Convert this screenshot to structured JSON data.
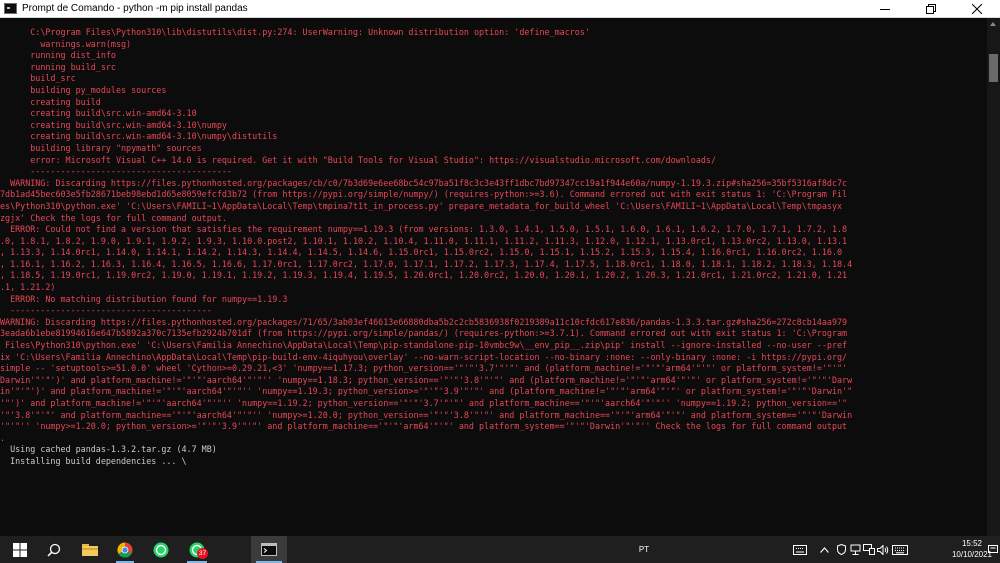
{
  "window": {
    "title": "Prompt de Comando - python  -m pip install pandas",
    "minimize_icon": "minimize-icon",
    "maximize_icon": "restore-icon",
    "close_icon": "close-icon"
  },
  "console": {
    "colors": {
      "error": "#e74856",
      "normal": "#cccccc",
      "background": "#0c0c0c"
    },
    "lines": [
      {
        "t": "      C:\\Program Files\\Python310\\lib\\distutils\\dist.py:274: UserWarning: Unknown distribution option: 'define_macros'",
        "c": "r"
      },
      {
        "t": "        warnings.warn(msg)",
        "c": "r"
      },
      {
        "t": "      running dist_info",
        "c": "r"
      },
      {
        "t": "      running build_src",
        "c": "r"
      },
      {
        "t": "      build_src",
        "c": "r"
      },
      {
        "t": "      building py_modules sources",
        "c": "r"
      },
      {
        "t": "      creating build",
        "c": "r"
      },
      {
        "t": "      creating build\\src.win-amd64-3.10",
        "c": "r"
      },
      {
        "t": "      creating build\\src.win-amd64-3.10\\numpy",
        "c": "r"
      },
      {
        "t": "      creating build\\src.win-amd64-3.10\\numpy\\distutils",
        "c": "r"
      },
      {
        "t": "      building library \"npymath\" sources",
        "c": "r"
      },
      {
        "t": "      error: Microsoft Visual C++ 14.0 is required. Get it with \"Build Tools for Visual Studio\": https://visualstudio.microsoft.com/downloads/",
        "c": "r"
      },
      {
        "t": "      ----------------------------------------",
        "c": "r"
      },
      {
        "t": "  WARNING: Discarding https://files.pythonhosted.org/packages/cb/c0/7b3d69e6ee68bc54c97ba51f8c3c3e43ff1dbc7bd97347cc19a1f944e60a/numpy-1.19.3.zip#sha256=35bf5316af8dc7c",
        "c": "r"
      },
      {
        "t": "7db1ad45bec603e5fb28671beb98ebd1d65e8059efcfd3b72 (from https://pypi.org/simple/numpy/) (requires-python:>=3.6). Command errored out with exit status 1: 'C:\\Program Fil",
        "c": "r"
      },
      {
        "t": "es\\Python310\\python.exe' 'C:\\Users\\FAMILI~1\\AppData\\Local\\Temp\\tmpina7t1t_in_process.py' prepare_metadata_for_build_wheel 'C:\\Users\\FAMILI~1\\AppData\\Local\\Temp\\tmpasyx",
        "c": "r"
      },
      {
        "t": "zgjx' Check the logs for full command output.",
        "c": "r"
      },
      {
        "t": "  ERROR: Could not find a version that satisfies the requirement numpy==1.19.3 (from versions: 1.3.0, 1.4.1, 1.5.0, 1.5.1, 1.6.0, 1.6.1, 1.6.2, 1.7.0, 1.7.1, 1.7.2, 1.8",
        "c": "r"
      },
      {
        "t": ".0, 1.8.1, 1.8.2, 1.9.0, 1.9.1, 1.9.2, 1.9.3, 1.10.0.post2, 1.10.1, 1.10.2, 1.10.4, 1.11.0, 1.11.1, 1.11.2, 1.11.3, 1.12.0, 1.12.1, 1.13.0rc1, 1.13.0rc2, 1.13.0, 1.13.1",
        "c": "r"
      },
      {
        "t": ", 1.13.3, 1.14.0rc1, 1.14.0, 1.14.1, 1.14.2, 1.14.3, 1.14.4, 1.14.5, 1.14.6, 1.15.0rc1, 1.15.0rc2, 1.15.0, 1.15.1, 1.15.2, 1.15.3, 1.15.4, 1.16.0rc1, 1.16.0rc2, 1.16.0",
        "c": "r"
      },
      {
        "t": ", 1.16.1, 1.16.2, 1.16.3, 1.16.4, 1.16.5, 1.16.6, 1.17.0rc1, 1.17.0rc2, 1.17.0, 1.17.1, 1.17.2, 1.17.3, 1.17.4, 1.17.5, 1.18.0rc1, 1.18.0, 1.18.1, 1.18.2, 1.18.3, 1.18.4",
        "c": "r"
      },
      {
        "t": ", 1.18.5, 1.19.0rc1, 1.19.0rc2, 1.19.0, 1.19.1, 1.19.2, 1.19.3, 1.19.4, 1.19.5, 1.20.0rc1, 1.20.0rc2, 1.20.0, 1.20.1, 1.20.2, 1.20.3, 1.21.0rc1, 1.21.0rc2, 1.21.0, 1.21",
        "c": "r"
      },
      {
        "t": ".1, 1.21.2)",
        "c": "r"
      },
      {
        "t": "  ERROR: No matching distribution found for numpy==1.19.3",
        "c": "r"
      },
      {
        "t": "  ----------------------------------------",
        "c": "r"
      },
      {
        "t": "WARNING: Discarding https://files.pythonhosted.org/packages/71/65/3ab03ef46613e66880dba5b2c2cb5836938f0219389a11c10cfdc617e836/pandas-1.3.3.tar.gz#sha256=272c8cb14aa979",
        "c": "r"
      },
      {
        "t": "3eada6b1ebe81994616e647b5892a370c7135efb2924b701df (from https://pypi.org/simple/pandas/) (requires-python:>=3.7.1). Command errored out with exit status 1: 'C:\\Program",
        "c": "r"
      },
      {
        "t": " Files\\Python310\\python.exe' 'C:\\Users\\Familia Annechino\\AppData\\Local\\Temp\\pip-standalone-pip-10vmbc9w\\__env_pip__.zip\\pip' install --ignore-installed --no-user --pref",
        "c": "r"
      },
      {
        "t": "ix 'C:\\Users\\Familia Annechino\\AppData\\Local\\Temp\\pip-build-env-4iquhyou\\overlay' --no-warn-script-location --no-binary :none: --only-binary :none: -i https://pypi.org/",
        "c": "r"
      },
      {
        "t": "simple -- 'setuptools>=51.0.0' wheel 'Cython>=0.29.21,<3' 'numpy==1.17.3; python_version=='\"'\"'3.7'\"'\"' and (platform_machine!='\"'\"'arm64'\"'\"' or platform_system!='\"'\"'",
        "c": "r"
      },
      {
        "t": "Darwin'\"'\"')' and platform_machine!='\"'\"'aarch64'\"'\"'' 'numpy==1.18.3; python_version=='\"'\"'3.8'\"'\"' and (platform_machine!='\"'\"'arm64'\"'\"' or platform_system!='\"'\"'Darw",
        "c": "r"
      },
      {
        "t": "in'\"'\"')' and platform_machine!='\"'\"'aarch64'\"'\"'' 'numpy==1.19.3; python_version>='\"'\"'3.9'\"'\"' and (platform_machine!='\"'\"'arm64'\"'\"' or platform_system!='\"'\"'Darwin'\"",
        "c": "r"
      },
      {
        "t": "'\"')' and platform_machine!='\"'\"'aarch64'\"'\"'' 'numpy==1.19.2; python_version=='\"'\"'3.7'\"'\"' and platform_machine=='\"'\"'aarch64'\"'\"'' 'numpy==1.19.2; python_version=='\"",
        "c": "r"
      },
      {
        "t": "'\"'3.8'\"'\"' and platform_machine=='\"'\"'aarch64'\"'\"'' 'numpy>=1.20.0; python_version=='\"'\"'3.8'\"'\"' and platform_machine=='\"'\"'arm64'\"'\"' and platform_system=='\"'\"'Darwin",
        "c": "r"
      },
      {
        "t": "'\"'\"'' 'numpy>=1.20.0; python_version>='\"'\"'3.9'\"'\"' and platform_machine=='\"'\"'arm64'\"'\"' and platform_system=='\"'\"'Darwin'\"'\"'' Check the logs for full command output",
        "c": "r"
      },
      {
        "t": ".",
        "c": "r"
      },
      {
        "t": "  Using cached pandas-1.3.2.tar.gz (4.7 MB)",
        "c": "w"
      },
      {
        "t": "  Installing build dependencies ... \\",
        "c": "w"
      }
    ]
  },
  "taskbar": {
    "start_icon": "windows-start-icon",
    "search_icon": "search-icon",
    "apps": [
      {
        "name": "file-explorer-icon"
      },
      {
        "name": "chrome-icon"
      },
      {
        "name": "whatsapp-icon"
      },
      {
        "name": "whatsapp-icon-2",
        "badge": "37"
      },
      {
        "name": "command-prompt-icon",
        "active": true
      }
    ],
    "language": "PT",
    "time": "15:52",
    "date": "10/10/2021"
  }
}
